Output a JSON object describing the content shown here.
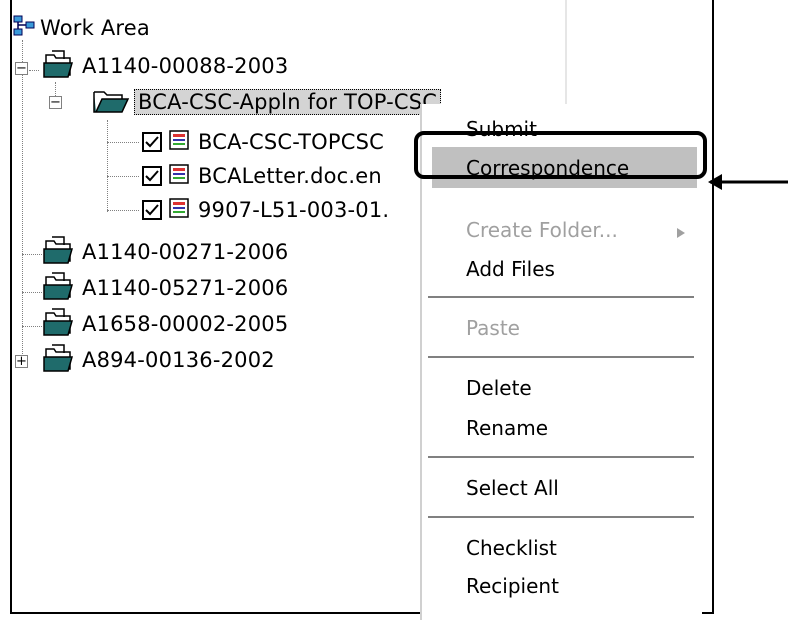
{
  "tree": {
    "root": {
      "label": "Work Area",
      "icon": "network-tree-icon"
    },
    "cases": [
      {
        "label": "A1140-00088-2003",
        "expanded": true,
        "icon": "case-folder-icon"
      },
      {
        "label": "A1140-00271-2006",
        "icon": "case-folder-icon"
      },
      {
        "label": "A1140-05271-2006",
        "icon": "case-folder-icon"
      },
      {
        "label": "A1658-00002-2005",
        "icon": "case-folder-icon"
      },
      {
        "label": "A894-00136-2002",
        "collapsed": true,
        "icon": "case-folder-icon"
      }
    ],
    "subfolder": {
      "label": "BCA-CSC-Appln for TOP-CSC",
      "selected": true,
      "icon": "open-folder-icon"
    },
    "files": [
      {
        "label": "BCA-CSC-TOPCSC",
        "checked": true,
        "icon": "document-icon"
      },
      {
        "label": "BCALetter.doc.en",
        "checked": true,
        "icon": "document-icon"
      },
      {
        "label": "9907-L51-003-01.",
        "checked": true,
        "icon": "document-icon"
      }
    ]
  },
  "context_menu": {
    "items": [
      {
        "label": "Submit",
        "enabled": true
      },
      {
        "label": "Correspondence",
        "enabled": true,
        "highlighted": true
      },
      {
        "label": "Create Folder...",
        "enabled": false,
        "has_submenu": true
      },
      {
        "label": "Add Files",
        "enabled": true
      },
      {
        "label": "Paste",
        "enabled": false
      },
      {
        "label": "Delete",
        "enabled": true
      },
      {
        "label": "Rename",
        "enabled": true
      },
      {
        "label": "Select All",
        "enabled": true
      },
      {
        "label": "Checklist",
        "enabled": true
      },
      {
        "label": "Recipient",
        "enabled": true
      }
    ],
    "submenu_icon": "triangle-right-icon"
  },
  "annotation": {
    "callout": "rounded-rectangle-highlight",
    "arrow_icon": "arrow-left-icon"
  },
  "colors": {
    "highlight": "#c0c0c0",
    "folder_teal": "#1f6b6b",
    "disabled": "#a0a0a0"
  }
}
